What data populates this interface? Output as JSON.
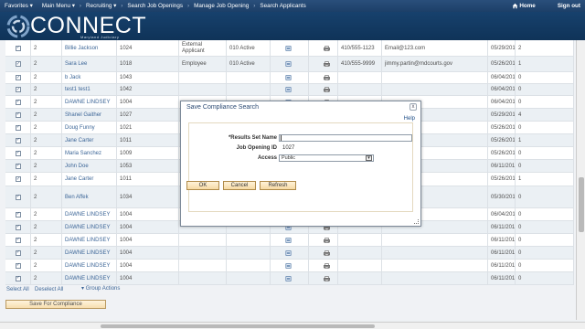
{
  "nav": {
    "favorites": "Favorites",
    "main_menu": "Main Menu",
    "recruiting": "Recruiting",
    "crumb1": "Search Job Openings",
    "crumb2": "Manage Job Opening",
    "crumb3": "Search Applicants",
    "home": "Home",
    "signout": "Sign out"
  },
  "brand": {
    "name": "CONNECT",
    "subtitle": "Maryland Judiciary"
  },
  "rows": [
    {
      "num": "2",
      "name": "Billie Jackson",
      "id": "1024",
      "type": "External Applicant",
      "status": "010 Active",
      "phone": "410/555-1123",
      "email": "Email@123.com",
      "date": "05/29/2015",
      "count": "2"
    },
    {
      "num": "2",
      "name": "Sara Lee",
      "id": "1018",
      "type": "Employee",
      "status": "010 Active",
      "phone": "410/555-9999",
      "email": "jimmy.partin@mdcourts.gov",
      "date": "05/26/2015",
      "count": "1"
    },
    {
      "num": "2",
      "name": "b Jack",
      "id": "1043",
      "type": "",
      "status": "",
      "phone": "",
      "email": "",
      "date": "06/04/2015",
      "count": "0"
    },
    {
      "num": "2",
      "name": "test1 test1",
      "id": "1042",
      "type": "",
      "status": "",
      "phone": "",
      "email": "",
      "date": "06/04/2015",
      "count": "0"
    },
    {
      "num": "2",
      "name": "DAWNE LINDSEY",
      "id": "1004",
      "type": "",
      "status": "",
      "phone": "",
      "email": "",
      "date": "06/04/2015",
      "count": "0"
    },
    {
      "num": "2",
      "name": "Shanel Gaither",
      "id": "1027",
      "type": "",
      "status": "",
      "phone": "",
      "email": "dcourts.gov",
      "date": "05/29/2015",
      "count": "4"
    },
    {
      "num": "2",
      "name": "Doug Funny",
      "id": "1021",
      "type": "",
      "status": "",
      "phone": "",
      "email": "dcourts.gov",
      "date": "05/26/2015",
      "count": "0"
    },
    {
      "num": "2",
      "name": "Jane Carter",
      "id": "1011",
      "type": "",
      "status": "",
      "phone": "",
      "email": "dcourts.gov",
      "date": "05/26/2015",
      "count": "1"
    },
    {
      "num": "2",
      "name": "Maria Sanchez",
      "id": "1009",
      "type": "",
      "status": "",
      "phone": "",
      "email": "dcourts.gov",
      "date": "05/26/2015",
      "count": "0"
    },
    {
      "num": "2",
      "name": "John Doe",
      "id": "1053",
      "type": "",
      "status": "",
      "phone": "",
      "email": "",
      "date": "06/11/2015",
      "count": "0"
    },
    {
      "num": "2",
      "name": "Jane Carter",
      "id": "1011",
      "type": "",
      "status": "",
      "phone": "",
      "email": "dcourts.gov",
      "date": "05/26/2015",
      "count": "1"
    },
    {
      "num": "2",
      "name": "Ben Affek",
      "id": "1034",
      "type": "",
      "status": "",
      "phone": "",
      "email": "om",
      "date": "05/30/2015",
      "count": "0"
    },
    {
      "num": "2",
      "name": "DAWNE LINDSEY",
      "id": "1004",
      "type": "",
      "status": "",
      "phone": "",
      "email": "",
      "date": "06/04/2015",
      "count": "0"
    },
    {
      "num": "2",
      "name": "DAWNE LINDSEY",
      "id": "1004",
      "type": "",
      "status": "",
      "phone": "",
      "email": "",
      "date": "06/11/2015",
      "count": "0"
    },
    {
      "num": "2",
      "name": "DAWNE LINDSEY",
      "id": "1004",
      "type": "",
      "status": "",
      "phone": "",
      "email": "",
      "date": "06/11/2015",
      "count": "0"
    },
    {
      "num": "2",
      "name": "DAWNE LINDSEY",
      "id": "1004",
      "type": "",
      "status": "",
      "phone": "",
      "email": "",
      "date": "06/11/2015",
      "count": "0"
    },
    {
      "num": "2",
      "name": "DAWNE LINDSEY",
      "id": "1004",
      "type": "",
      "status": "",
      "phone": "",
      "email": "",
      "date": "06/11/2015",
      "count": "0"
    },
    {
      "num": "2",
      "name": "DAWNE LINDSEY",
      "id": "1004",
      "type": "",
      "status": "",
      "phone": "",
      "email": "",
      "date": "06/11/2015",
      "count": "0"
    }
  ],
  "actions": {
    "select_all": "Select All",
    "deselect_all": "Deselect All",
    "group_actions": "Group Actions",
    "save_compliance": "Save For Compliance"
  },
  "modal": {
    "title": "Save Compliance Search",
    "close": "x",
    "help": "Help",
    "results_label": "*Results Set Name",
    "results_value": "",
    "job_id_label": "Job Opening ID",
    "job_id_value": "1027",
    "access_label": "Access",
    "access_value": "Public",
    "ok": "OK",
    "cancel": "Cancel",
    "refresh": "Refresh"
  },
  "colors": {
    "nav_bg": "#1d3f68",
    "banner_bg": "#0f3358",
    "link": "#1f4f88",
    "button_bg": "#f6d9a4"
  }
}
